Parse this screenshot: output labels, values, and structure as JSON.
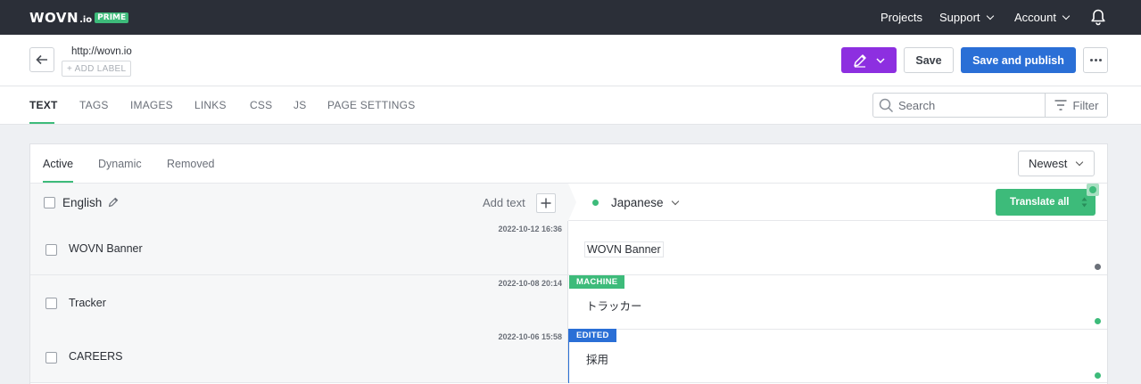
{
  "brand": {
    "name": "WOVN",
    "suffix": ".io",
    "tier": "PRIME"
  },
  "topnav": {
    "projects": "Projects",
    "support": "Support",
    "account": "Account"
  },
  "page": {
    "url": "http://wovn.io",
    "add_label": "+ ADD LABEL"
  },
  "actions": {
    "save": "Save",
    "publish": "Save and publish"
  },
  "tabs": [
    {
      "label": "TEXT",
      "active": true
    },
    {
      "label": "TAGS"
    },
    {
      "label": "IMAGES"
    },
    {
      "label": "LINKS"
    },
    {
      "label": "CSS"
    },
    {
      "label": "JS"
    },
    {
      "label": "PAGE SETTINGS"
    }
  ],
  "search": {
    "placeholder": "Search"
  },
  "filter": {
    "label": "Filter"
  },
  "subtabs": [
    {
      "label": "Active",
      "active": true
    },
    {
      "label": "Dynamic"
    },
    {
      "label": "Removed"
    }
  ],
  "sort": {
    "selected": "Newest"
  },
  "source_lang": "English",
  "add_text": "Add text",
  "target_lang": "Japanese",
  "translate_all": "Translate all",
  "rows": [
    {
      "date": "2022-10-12 16:36",
      "source": "WOVN Banner",
      "target": "WOVN Banner",
      "badge": "",
      "status_color": "#6b7079"
    },
    {
      "date": "2022-10-08 20:14",
      "source": "Tracker",
      "target": "トラッカー",
      "badge": "MACHINE",
      "status_color": "#3dbb7a"
    },
    {
      "date": "2022-10-06 15:58",
      "source": "CAREERS",
      "target": "採用",
      "badge": "EDITED",
      "status_color": "#3dbb7a"
    }
  ],
  "colors": {
    "accent_green": "#3dbb7a",
    "primary_blue": "#2a6fd6",
    "edit_purple": "#8d2fe0",
    "nav_bg": "#2b2f38"
  }
}
